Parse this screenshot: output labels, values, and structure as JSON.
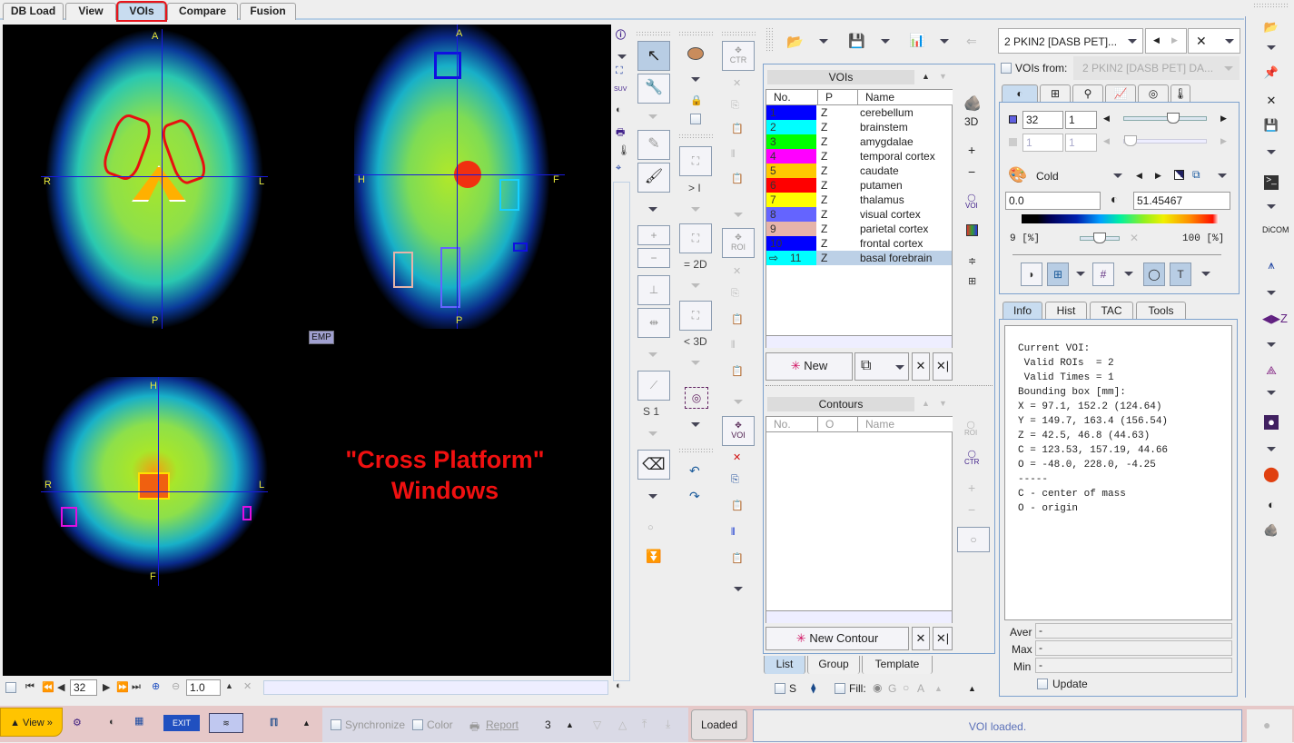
{
  "tabs": [
    {
      "label": "DB Load",
      "active": false
    },
    {
      "label": "View",
      "active": false
    },
    {
      "label": "VOIs",
      "active": true
    },
    {
      "label": "Compare",
      "active": false
    },
    {
      "label": "Fusion",
      "active": false
    }
  ],
  "viewer": {
    "axial": {
      "top": "A",
      "bottom": "P",
      "left": "R",
      "right": "L"
    },
    "sagittal": {
      "top": "A",
      "bottom": "P",
      "left": "H",
      "right": "F"
    },
    "coronal": {
      "top": "H",
      "bottom": "F",
      "left": "R",
      "right": "L"
    },
    "emp_badge": "EMP",
    "overlay_line1": "\"Cross Platform\"",
    "overlay_line2": "Windows"
  },
  "viewer_toolbar": {
    "slice_value": "32",
    "zoom_value": "1.0"
  },
  "tool_column": {
    "label_gt_i": "> I",
    "label_eq_2d": "= 2D",
    "label_lt_3d": "< 3D",
    "label_s1": "S 1",
    "ctr_label": "CTR",
    "roi_label": "ROI",
    "voi_label": "VOI"
  },
  "vois": {
    "header": "VOIs",
    "columns": [
      "No.",
      "P",
      "Name"
    ],
    "rows": [
      {
        "no": "1",
        "p": "Z",
        "name": "cerebellum",
        "color": "#0000ff"
      },
      {
        "no": "2",
        "p": "Z",
        "name": "brainstem",
        "color": "#00ffff"
      },
      {
        "no": "3",
        "p": "Z",
        "name": "amygdalae",
        "color": "#00ff00"
      },
      {
        "no": "4",
        "p": "Z",
        "name": "temporal cortex",
        "color": "#ff00ff"
      },
      {
        "no": "5",
        "p": "Z",
        "name": "caudate",
        "color": "#ffc800"
      },
      {
        "no": "6",
        "p": "Z",
        "name": "putamen",
        "color": "#ff0000"
      },
      {
        "no": "7",
        "p": "Z",
        "name": "thalamus",
        "color": "#ffff00"
      },
      {
        "no": "8",
        "p": "Z",
        "name": "visual cortex",
        "color": "#6464ff"
      },
      {
        "no": "9",
        "p": "Z",
        "name": "parietal cortex",
        "color": "#e6b4aa"
      },
      {
        "no": "10",
        "p": "Z",
        "name": "frontal cortex",
        "color": "#0000ff"
      },
      {
        "no": "11",
        "p": "Z",
        "name": "basal forebrain",
        "color": "#00ffff",
        "selected": true
      }
    ],
    "side_3d": "3D",
    "side_plus": "+",
    "side_minus": "−",
    "side_voi": "VOI",
    "new_label": "New"
  },
  "contours": {
    "header": "Contours",
    "columns": [
      "No.",
      "O",
      "Name"
    ],
    "new_label": "New Contour",
    "side_roi": "ROI",
    "side_ctr": "CTR"
  },
  "list_tabs": [
    {
      "label": "List",
      "active": true
    },
    {
      "label": "Group",
      "active": false
    },
    {
      "label": "Template",
      "active": false
    }
  ],
  "list_footer": {
    "s_label": "S",
    "fill_label": "Fill:",
    "g_label": "G",
    "a_label": "A"
  },
  "series": {
    "selector": "2 PKIN2 [DASB PET]...",
    "vois_from_label": "VOIs from:",
    "vois_from_value": "2 PKIN2 [DASB PET] DA..."
  },
  "image_controls": {
    "slice": "32",
    "frame": "1",
    "slice2": "1",
    "frame2": "1",
    "slice_slider_fraction": 0.6,
    "colormap": "Cold",
    "min_value": "0.0",
    "max_value": "51.45467",
    "lower_pct": "9",
    "upper_pct": "100",
    "pct_unit": "[%]",
    "threshold_slider_fraction": 0.45
  },
  "info_tabs": [
    {
      "label": "Info",
      "active": true
    },
    {
      "label": "Hist",
      "active": false
    },
    {
      "label": "TAC",
      "active": false
    },
    {
      "label": "Tools",
      "active": false
    }
  ],
  "info_text": "Current VOI:\n Valid ROIs  = 2\n Valid Times = 1\nBounding box [mm]:\nX = 97.1, 152.2 (124.64)\nY = 149.7, 163.4 (156.54)\nZ = 42.5, 46.8 (44.63)\nC = 123.53, 157.19, 44.66\nO = -48.0, 228.0, -4.25\n-----\nC - center of mass\nO - origin",
  "stats": {
    "aver_label": "Aver",
    "aver_value": "-",
    "max_label": "Max",
    "max_value": "-",
    "min_label": "Min",
    "min_value": "-",
    "update_label": "Update"
  },
  "status": {
    "view_button": "▲ View »",
    "synchronize_label": "Synchronize",
    "synchronize_checked": true,
    "color_label": "Color",
    "report_label": "Report",
    "count": "3",
    "loaded_button": "Loaded",
    "message": "VOI loaded."
  }
}
